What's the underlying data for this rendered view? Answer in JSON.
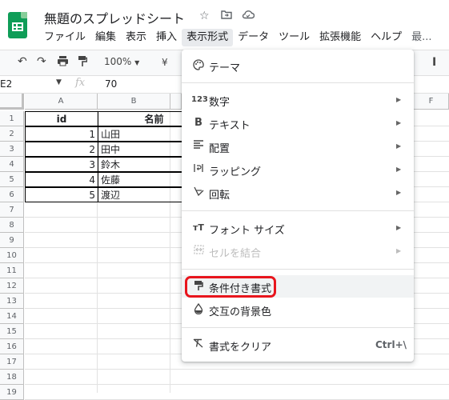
{
  "app": {
    "title": "無題のスプレッドシート",
    "menus": [
      "ファイル",
      "編集",
      "表示",
      "挿入",
      "表示形式",
      "データ",
      "ツール",
      "拡張機能",
      "ヘルプ",
      "最..."
    ]
  },
  "toolbar": {
    "zoom": "100%",
    "currency": "¥",
    "right_icons": [
      "B",
      "I"
    ]
  },
  "formula_bar": {
    "name_box": "E2",
    "fx": "fx",
    "value": "70"
  },
  "grid": {
    "columns": [
      "A",
      "B",
      "",
      "",
      "",
      "F"
    ],
    "rows": [
      "1",
      "2",
      "3",
      "4",
      "5",
      "6",
      "7",
      "8",
      "9",
      "10",
      "11",
      "12",
      "13",
      "14",
      "15",
      "16",
      "17",
      "18",
      "19"
    ],
    "header": {
      "id": "id",
      "name": "名前"
    },
    "data": [
      {
        "id": "1",
        "name": "山田"
      },
      {
        "id": "2",
        "name": "田中"
      },
      {
        "id": "3",
        "name": "鈴木"
      },
      {
        "id": "4",
        "name": "佐藤"
      },
      {
        "id": "5",
        "name": "渡辺"
      }
    ]
  },
  "format_menu": {
    "theme": "テーマ",
    "number": "数字",
    "text": "テキスト",
    "align": "配置",
    "wrap": "ラッピング",
    "rotate": "回転",
    "font_size": "フォント サイズ",
    "merge": "セルを結合",
    "conditional": "条件付き書式",
    "alternating": "交互の背景色",
    "clear": "書式をクリア",
    "clear_shortcut": "Ctrl+\\"
  },
  "icons": {
    "theme": "palette-icon",
    "number": "123",
    "text": "B",
    "highlight_color": "#e8151d",
    "sheets_green": "#0f9d58"
  }
}
